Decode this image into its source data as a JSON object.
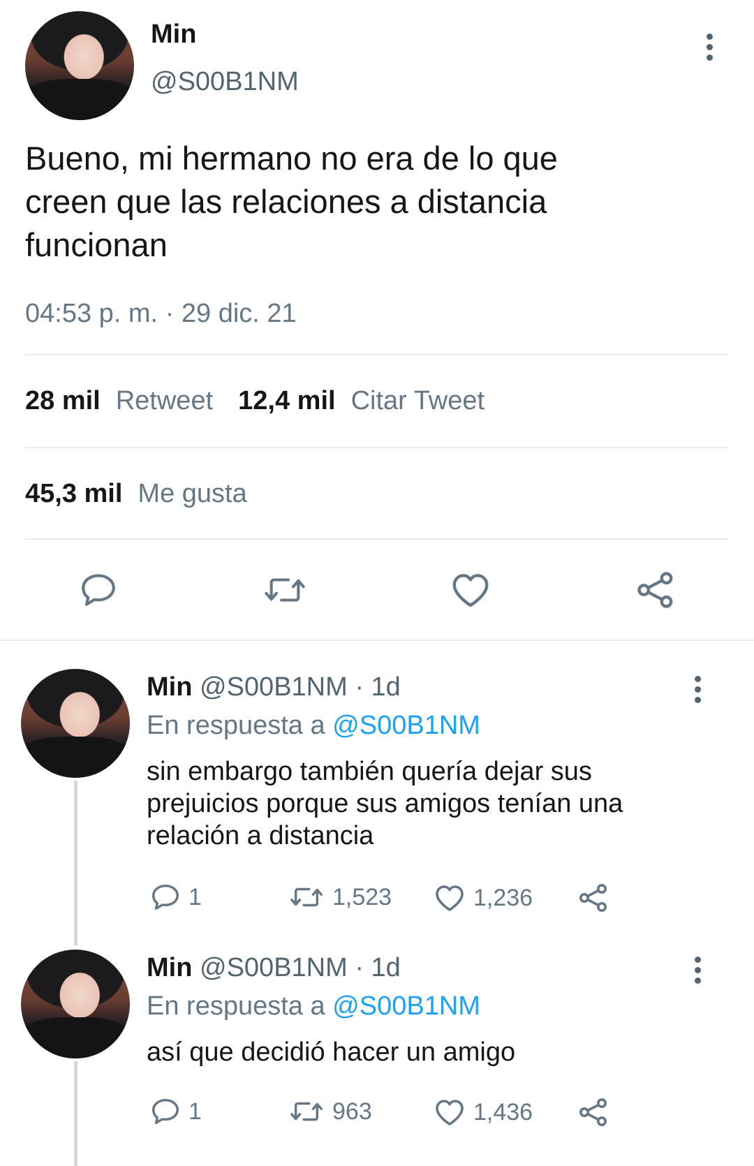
{
  "main_tweet": {
    "name": "Min",
    "handle": "@S00B1NM",
    "text": "Bueno, mi hermano no era de lo que creen que las relaciones a distancia funcionan",
    "text_lines": [
      "Bueno, mi hermano no era de lo que",
      "creen que las relaciones a distancia",
      "funcionan"
    ],
    "timestamp": "04:53 p. m. · 29 dic. 21",
    "retweets": {
      "count": "28 mil",
      "label": "Retweet"
    },
    "quotes": {
      "count": "12,4 mil",
      "label": "Citar Tweet"
    },
    "likes": {
      "count": "45,3 mil",
      "label": "Me gusta"
    }
  },
  "replies": [
    {
      "name": "Min",
      "handle": "@S00B1NM",
      "age": "· 1d",
      "reply_prefix": "En respuesta a",
      "reply_to": "@S00B1NM",
      "text_lines": [
        "sin embargo también quería dejar sus",
        "prejuicios porque sus amigos tenían una",
        "relación a distancia"
      ],
      "reply_count": "1",
      "retweet_count": "1,523",
      "like_count": "1,236"
    },
    {
      "name": "Min",
      "handle": "@S00B1NM",
      "age": "· 1d",
      "reply_prefix": "En respuesta a",
      "reply_to": "@S00B1NM",
      "text_lines": [
        "así que decidió hacer un amigo"
      ],
      "reply_count": "1",
      "retweet_count": "963",
      "like_count": "1,436"
    }
  ],
  "icons": {
    "reply": "speech-bubble-icon",
    "retweet": "retweet-arrows-icon",
    "like": "heart-icon",
    "share": "share-nodes-icon",
    "more": "vertical-dots-icon"
  },
  "colors": {
    "link": "#1da1f2",
    "secondary_text": "#657786",
    "divider": "#e6ecf0"
  }
}
